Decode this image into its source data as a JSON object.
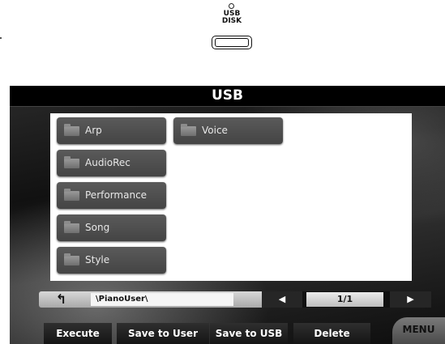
{
  "panel": {
    "usb_label_line1": "USB",
    "usb_label_line2": "DISK"
  },
  "screen": {
    "title": "USB",
    "folders": [
      {
        "label": "Arp"
      },
      {
        "label": "AudioRec"
      },
      {
        "label": "Performance"
      },
      {
        "label": "Song"
      },
      {
        "label": "Style"
      },
      {
        "label": "Voice"
      }
    ],
    "nav": {
      "up_icon": "↰",
      "path": "\\PianoUser\\",
      "prev_icon": "◀",
      "page": "1/1",
      "next_icon": "▶"
    },
    "functions": {
      "execute": "Execute",
      "save_to_user": "Save to User",
      "save_to_usb": "Save to USB",
      "delete": "Delete",
      "menu": "MENU"
    }
  },
  "colors": {
    "title_bar": "#000000",
    "folder_button": "#4a4a4a",
    "file_area": "#ffffff"
  }
}
